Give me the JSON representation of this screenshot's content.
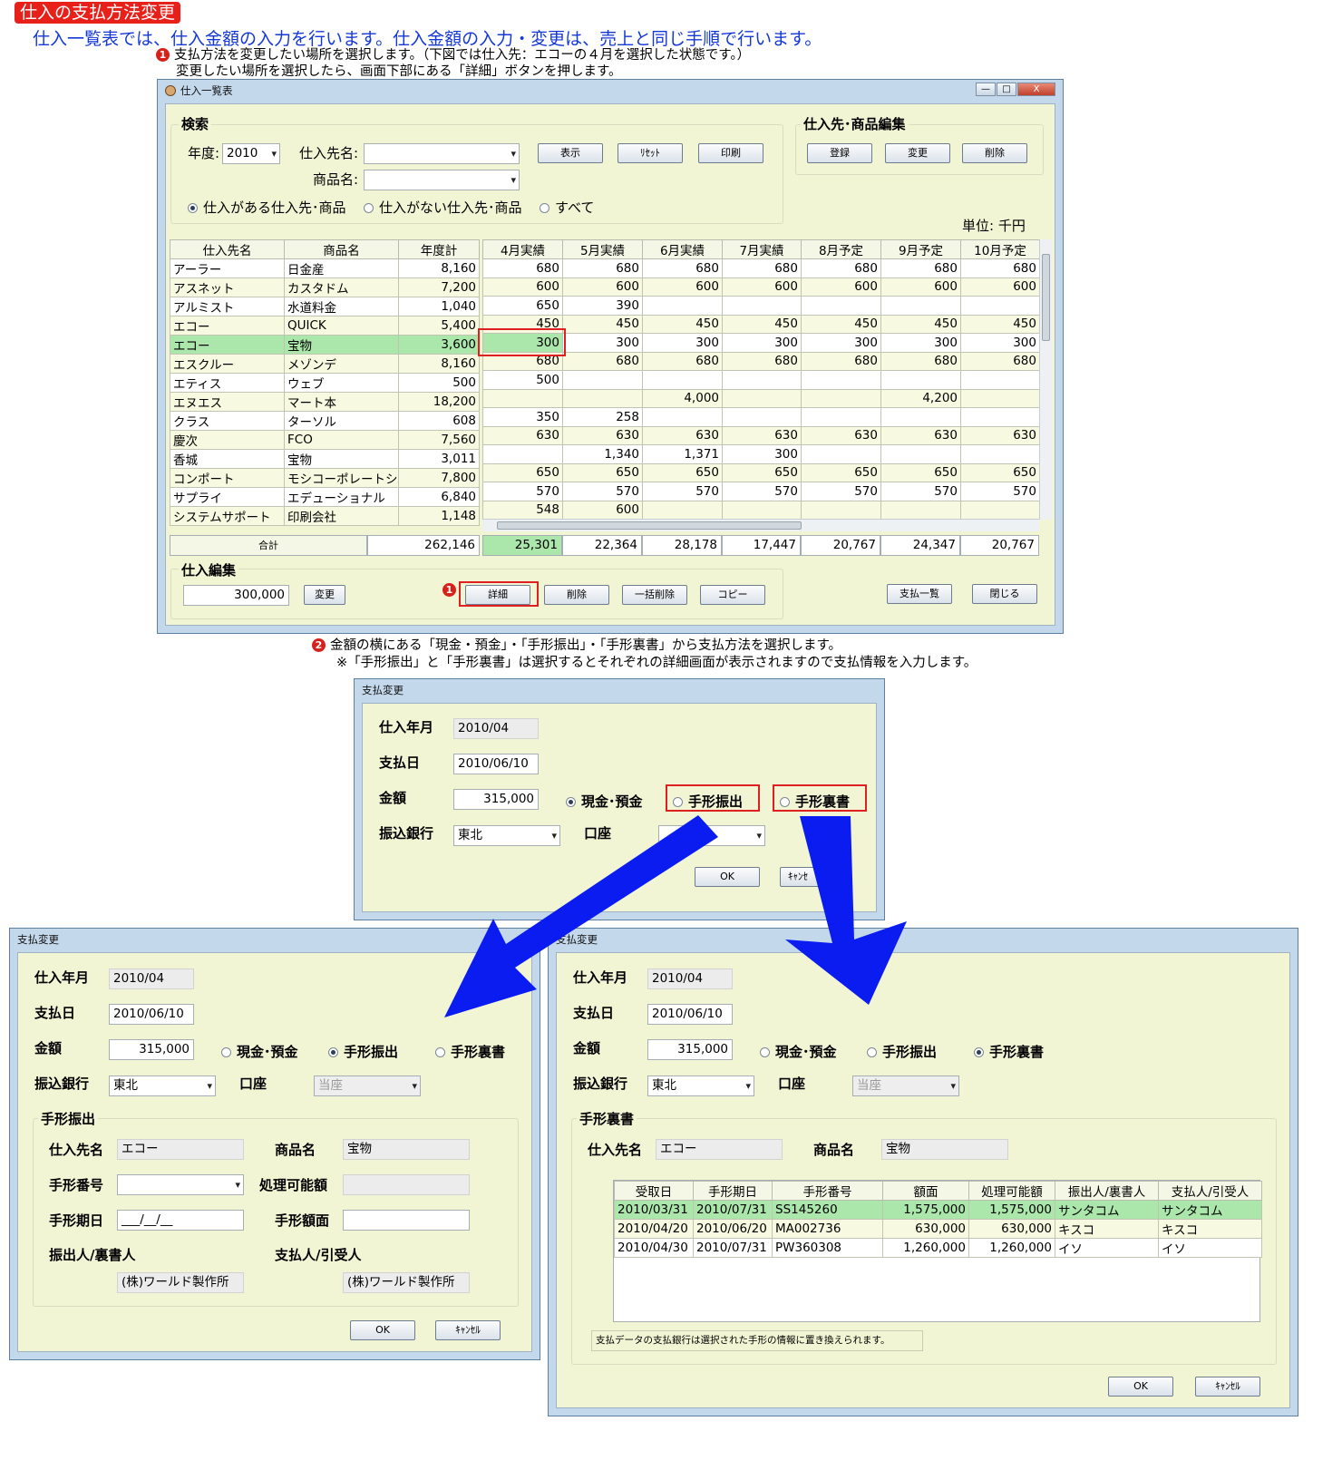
{
  "page_title": "仕入の支払方法変更",
  "intro": "仕入一覧表では、仕入金額の入力を行います。仕入金額の入力・変更は、売上と同じ手順で行います。",
  "step1": {
    "num": "1",
    "line1": "支払方法を変更したい場所を選択します。（下図では仕入先：エコーの４月を選択した状態です。）",
    "line2": "変更したい場所を選択したら、画面下部にある「詳細」ボタンを押します。"
  },
  "step2": {
    "num": "2",
    "line1": "金額の横にある「現金・預金」・「手形振出」・「手形裏書」から支払方法を選択します。",
    "line2": "※「手形振出」と「手形裏書」は選択するとそれぞれの詳細画面が表示されますので支払情報を入力します。"
  },
  "list_window": {
    "title": "仕入一覧表",
    "controls": [
      "—",
      "□",
      "X"
    ],
    "search": {
      "label": "検索",
      "year_label": "年度:",
      "year_value": "2010",
      "supplier_label": "仕入先名:",
      "supplier_value": "",
      "product_label": "商品名:",
      "product_value": "",
      "buttons": [
        "表示",
        "ﾘｾｯﾄ",
        "印刷"
      ],
      "radios": [
        {
          "label": "仕入がある仕入先･商品",
          "checked": true
        },
        {
          "label": "仕入がない仕入先･商品",
          "checked": false
        },
        {
          "label": "すべて",
          "checked": false
        }
      ]
    },
    "edit_group": {
      "label": "仕入先･商品編集",
      "buttons": [
        "登録",
        "変更",
        "削除"
      ]
    },
    "unit": "単位:  千円",
    "left_headers": [
      "仕入先名",
      "商品名",
      "年度計"
    ],
    "right_headers": [
      "4月実績",
      "5月実績",
      "6月実績",
      "7月実績",
      "8月予定",
      "9月予定",
      "10月予定"
    ],
    "rows": [
      {
        "supplier": "アーラー",
        "product": "日金産",
        "total": "8,160",
        "months": [
          "680",
          "680",
          "680",
          "680",
          "680",
          "680",
          "680"
        ]
      },
      {
        "supplier": "アスネット",
        "product": "カスタドム",
        "total": "7,200",
        "months": [
          "600",
          "600",
          "600",
          "600",
          "600",
          "600",
          "600"
        ]
      },
      {
        "supplier": "アルミスト",
        "product": "水道料金",
        "total": "1,040",
        "months": [
          "650",
          "390",
          "",
          "",
          "",
          "",
          ""
        ]
      },
      {
        "supplier": "エコー",
        "product": "QUICK",
        "total": "5,400",
        "months": [
          "450",
          "450",
          "450",
          "450",
          "450",
          "450",
          "450"
        ]
      },
      {
        "supplier": "エコー",
        "product": "宝物",
        "total": "3,600",
        "months": [
          "300",
          "300",
          "300",
          "300",
          "300",
          "300",
          "300"
        ],
        "selected": true
      },
      {
        "supplier": "エスクルー",
        "product": "メゾンデ",
        "total": "8,160",
        "months": [
          "680",
          "680",
          "680",
          "680",
          "680",
          "680",
          "680"
        ]
      },
      {
        "supplier": "エティス",
        "product": "ウェブ",
        "total": "500",
        "months": [
          "500",
          "",
          "",
          "",
          "",
          "",
          ""
        ]
      },
      {
        "supplier": "エヌエス",
        "product": "マート本",
        "total": "18,200",
        "months": [
          "",
          "",
          "4,000",
          "",
          "",
          "4,200",
          ""
        ]
      },
      {
        "supplier": "クラス",
        "product": "ターソル",
        "total": "608",
        "months": [
          "350",
          "258",
          "",
          "",
          "",
          "",
          ""
        ]
      },
      {
        "supplier": "慶次",
        "product": "FCO",
        "total": "7,560",
        "months": [
          "630",
          "630",
          "630",
          "630",
          "630",
          "630",
          "630"
        ]
      },
      {
        "supplier": "香城",
        "product": "宝物",
        "total": "3,011",
        "months": [
          "",
          "1,340",
          "1,371",
          "300",
          "",
          "",
          ""
        ]
      },
      {
        "supplier": "コンポート",
        "product": "モシコーポレートショ",
        "total": "7,800",
        "months": [
          "650",
          "650",
          "650",
          "650",
          "650",
          "650",
          "650"
        ]
      },
      {
        "supplier": "サプライ",
        "product": "エデューショナル",
        "total": "6,840",
        "months": [
          "570",
          "570",
          "570",
          "570",
          "570",
          "570",
          "570"
        ]
      },
      {
        "supplier": "システムサポート",
        "product": "印刷会社",
        "total": "1,148",
        "months": [
          "548",
          "600",
          "",
          "",
          "",
          "",
          ""
        ]
      }
    ],
    "totals": {
      "label": "合計",
      "year": "262,146",
      "months": [
        "25,301",
        "22,364",
        "28,178",
        "17,447",
        "20,767",
        "24,347",
        "20,767"
      ]
    },
    "purchase_edit": {
      "label": "仕入編集",
      "value": "300,000",
      "change": "変更"
    },
    "step_marker": "1",
    "bottom_buttons": [
      "詳細",
      "削除",
      "一括削除",
      "コピー"
    ],
    "right_buttons": [
      "支払一覧",
      "閉じる"
    ]
  },
  "pay_dialog": {
    "title": "支払変更",
    "month_label": "仕入年月",
    "month_value": "2010/04",
    "date_label": "支払日",
    "date_value": "2010/06/10",
    "amount_label": "金額",
    "amount_value": "315,000",
    "radio_cash": "現金･預金",
    "radio_issue": "手形振出",
    "radio_endorse": "手形裏書",
    "bank_label": "振込銀行",
    "bank_value": "東北",
    "account_label": "口座",
    "account_value": "",
    "ok": "OK",
    "cancel": "ｷｬﾝｾﾙ",
    "cancel_visible": "ｷｬﾝｾ"
  },
  "issue_dialog": {
    "title": "支払変更",
    "month_label": "仕入年月",
    "month_value": "2010/04",
    "date_label": "支払日",
    "date_value": "2010/06/10",
    "amount_label": "金額",
    "amount_value": "315,000",
    "radio_cash": "現金･預金",
    "radio_issue": "手形振出",
    "radio_endorse": "手形裏書",
    "bank_label": "振込銀行",
    "bank_value": "東北",
    "account_label": "口座",
    "account_value": "当座",
    "group_label": "手形振出",
    "supplier_label": "仕入先名",
    "supplier_value": "エコー",
    "product_label": "商品名",
    "product_value": "宝物",
    "note_no_label": "手形番号",
    "note_no_value": "",
    "processable_label": "処理可能額",
    "processable_value": "",
    "due_label": "手形期日",
    "due_value": "___/__/__",
    "face_label": "手形額面",
    "face_value": "",
    "drawer_label": "振出人/裏書人",
    "drawer_value": "(株)ワールド製作所",
    "payee_label": "支払人/引受人",
    "payee_value": "(株)ワールド製作所",
    "ok": "OK",
    "cancel": "ｷｬﾝｾﾙ"
  },
  "endorse_dialog": {
    "title": "支払変更",
    "month_label": "仕入年月",
    "month_value": "2010/04",
    "date_label": "支払日",
    "date_value": "2010/06/10",
    "amount_label": "金額",
    "amount_value": "315,000",
    "radio_cash": "現金･預金",
    "radio_issue": "手形振出",
    "radio_endorse": "手形裏書",
    "bank_label": "振込銀行",
    "bank_value": "東北",
    "account_label": "口座",
    "account_value": "当座",
    "group_label": "手形裏書",
    "supplier_label": "仕入先名",
    "supplier_value": "エコー",
    "product_label": "商品名",
    "product_value": "宝物",
    "headers": [
      "受取日",
      "手形期日",
      "手形番号",
      "額面",
      "処理可能額",
      "振出人/裏書人",
      "支払人/引受人"
    ],
    "rows": [
      [
        "2010/03/31",
        "2010/07/31",
        "SS145260",
        "1,575,000",
        "1,575,000",
        "サンタコム",
        "サンタコム"
      ],
      [
        "2010/04/20",
        "2010/06/20",
        "MA002736",
        "630,000",
        "630,000",
        "キスコ",
        "キスコ"
      ],
      [
        "2010/04/30",
        "2010/07/31",
        "PW360308",
        "1,260,000",
        "1,260,000",
        "イソ",
        "イソ"
      ]
    ],
    "footnote": "支払データの支払銀行は選択された手形の情報に置き換えられます。",
    "ok": "OK",
    "cancel": "ｷｬﾝｾﾙ"
  },
  "colors": {
    "accent_red": "#e8201a",
    "intro_blue": "#1438d8",
    "arrow_blue": "#0a1cf0",
    "selected_row": "#abe6ab",
    "client_bg": "#f2f5d4"
  },
  "icons": [
    "user-icon",
    "minimize-icon",
    "maximize-icon",
    "close-icon",
    "dropdown-arrow-icon",
    "scroll-arrow-icon"
  ]
}
